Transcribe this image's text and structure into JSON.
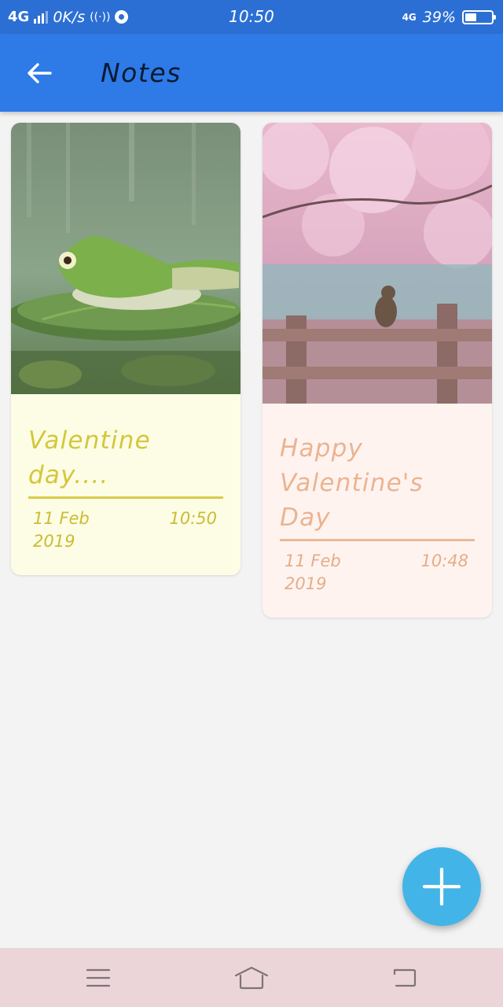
{
  "status_bar": {
    "network": "4G",
    "speed": "0K/s",
    "time": "10:50",
    "network_right": "4G",
    "battery": "39%",
    "battery_level": 0.39
  },
  "app_bar": {
    "title": "Notes",
    "color": "#2e7ae6"
  },
  "notes": [
    {
      "title": "Valentine day....",
      "date": "11 Feb 2019",
      "time": "10:50",
      "image": "frog-on-lily-pad",
      "background": "#fdfce5",
      "accent": "#d3c73a"
    },
    {
      "title": "Happy Valentine's Day",
      "date": "11 Feb 2019",
      "time": "10:48",
      "image": "cat-on-fence-cherry-blossoms",
      "background": "#fff3f0",
      "accent": "#eab490"
    }
  ],
  "fab": {
    "icon": "plus-icon",
    "color": "#43b4e8"
  },
  "nav_bar": {
    "icons": [
      "menu-icon",
      "home-icon",
      "back-nav-icon"
    ]
  }
}
